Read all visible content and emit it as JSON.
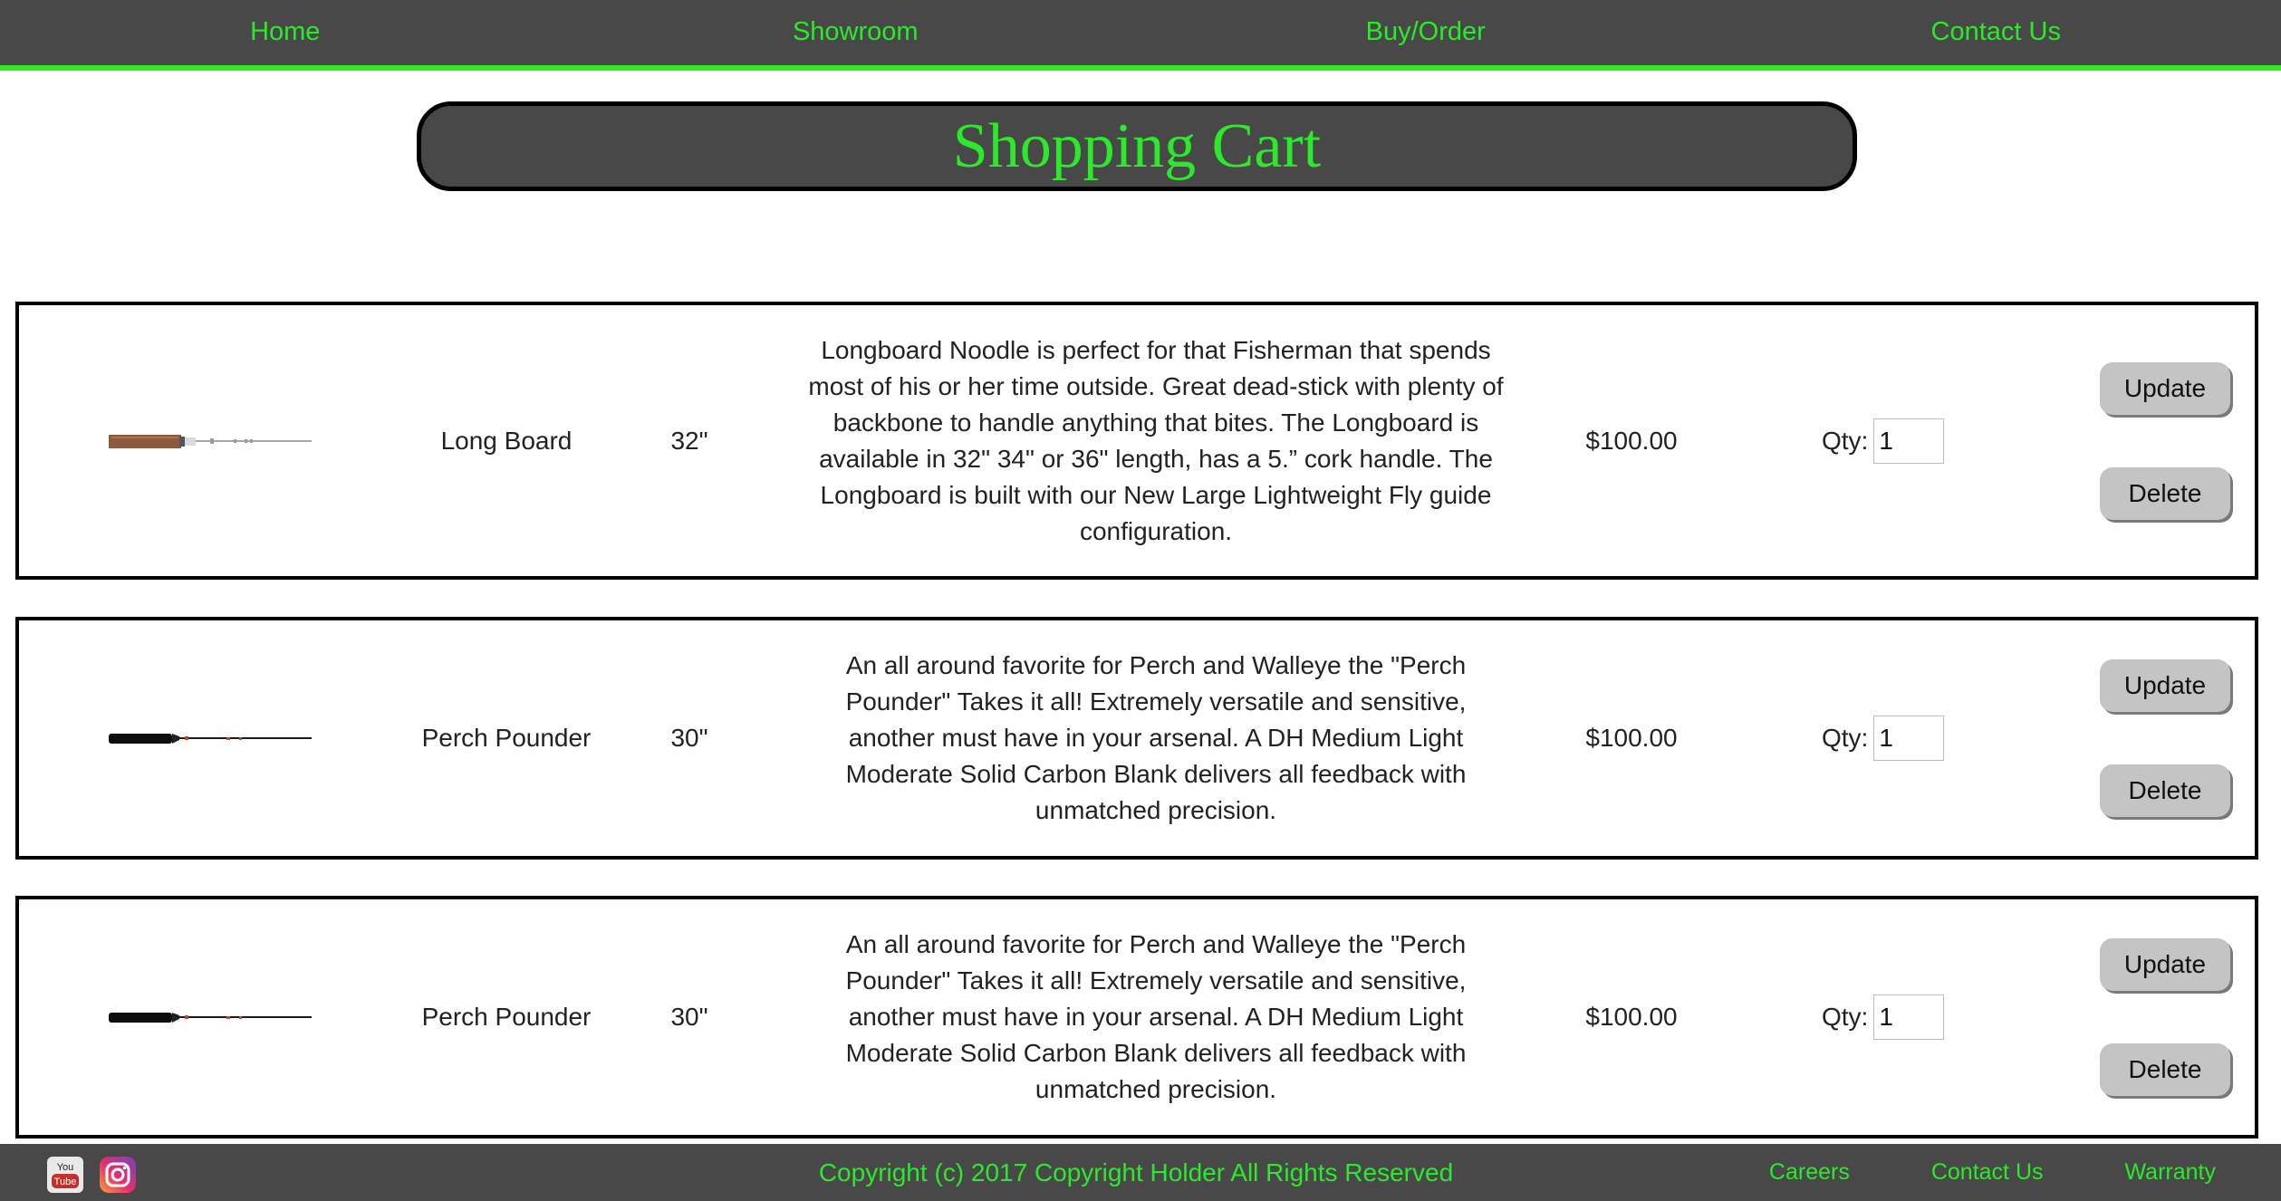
{
  "nav": {
    "items": [
      "Home",
      "Showroom",
      "Buy/Order",
      "Contact Us"
    ]
  },
  "page": {
    "title": "Shopping Cart"
  },
  "cart": {
    "items": [
      {
        "name": "Long Board",
        "length": "32\"",
        "description": "Longboard Noodle is perfect for that Fisherman that spends most of his or her time outside. Great dead-stick with plenty of backbone to handle anything that bites. The Longboard is available in 32\" 34\" or 36\" length, has a 5.” cork handle. The Longboard is built with our New Large Lightweight Fly guide configuration.",
        "price": "$100.00",
        "qty_label": "Qty:",
        "qty": "1",
        "update_label": "Update",
        "delete_label": "Delete",
        "image_icon": "cork-handle-rod-icon"
      },
      {
        "name": "Perch Pounder",
        "length": "30\"",
        "description": "An all around favorite for Perch and Walleye the \"Perch Pounder\" Takes it all! Extremely versatile and sensitive, another must have in your arsenal. A DH Medium Light Moderate Solid Carbon Blank delivers all feedback with unmatched precision.",
        "price": "$100.00",
        "qty_label": "Qty:",
        "qty": "1",
        "update_label": "Update",
        "delete_label": "Delete",
        "image_icon": "black-handle-rod-icon"
      },
      {
        "name": "Perch Pounder",
        "length": "30\"",
        "description": "An all around favorite for Perch and Walleye the \"Perch Pounder\" Takes it all! Extremely versatile and sensitive, another must have in your arsenal. A DH Medium Light Moderate Solid Carbon Blank delivers all feedback with unmatched precision.",
        "price": "$100.00",
        "qty_label": "Qty:",
        "qty": "1",
        "update_label": "Update",
        "delete_label": "Delete",
        "image_icon": "black-handle-rod-icon"
      }
    ]
  },
  "footer": {
    "copyright": "Copyright (c) 2017 Copyright Holder All Rights Reserved",
    "links": [
      "Careers",
      "Contact Us",
      "Warranty"
    ],
    "social": [
      "youtube-icon",
      "instagram-icon"
    ]
  },
  "colors": {
    "bar": "#484848",
    "accent_green": "#2aea2a",
    "button_gray": "#c4c4c4"
  }
}
